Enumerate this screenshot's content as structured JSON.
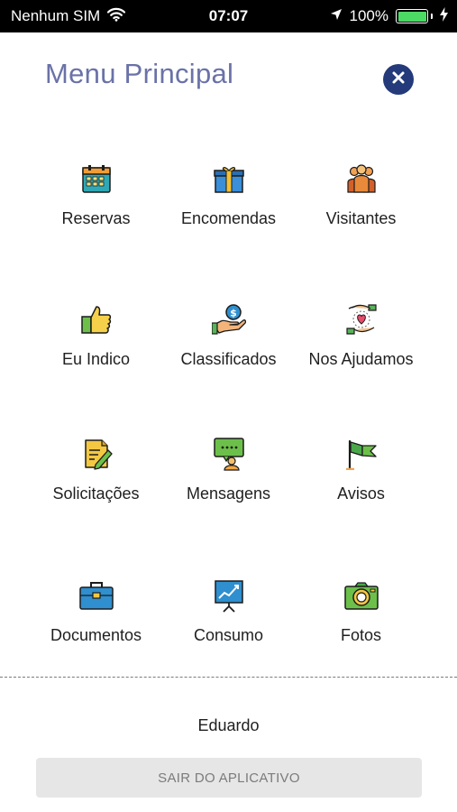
{
  "status_bar": {
    "carrier": "Nenhum SIM",
    "time": "07:07",
    "battery": "100%",
    "battery_level": 1.0
  },
  "header": {
    "title": "Menu Principal",
    "close_icon": "close-circle-icon"
  },
  "menu": {
    "items": [
      {
        "label": "Reservas",
        "icon": "calendar-icon"
      },
      {
        "label": "Encomendas",
        "icon": "gift-package-icon"
      },
      {
        "label": "Visitantes",
        "icon": "people-group-icon"
      },
      {
        "label": "Eu Indico",
        "icon": "thumbs-up-icon"
      },
      {
        "label": "Classificados",
        "icon": "money-hand-icon"
      },
      {
        "label": "Nos Ajudamos",
        "icon": "helping-hands-heart-icon"
      },
      {
        "label": "Solicitações",
        "icon": "document-pencil-icon"
      },
      {
        "label": "Mensagens",
        "icon": "chat-person-icon"
      },
      {
        "label": "Avisos",
        "icon": "flag-icon"
      },
      {
        "label": "Documentos",
        "icon": "briefcase-icon"
      },
      {
        "label": "Consumo",
        "icon": "chart-board-icon"
      },
      {
        "label": "Fotos",
        "icon": "camera-icon"
      }
    ]
  },
  "footer": {
    "user_name": "Eduardo",
    "logout_label": "SAIR DO APLICATIVO"
  },
  "colors": {
    "title": "#6a72a8",
    "close_button": "#243a7a",
    "battery": "#4cd964",
    "logout_bg": "#e6e6e6"
  }
}
